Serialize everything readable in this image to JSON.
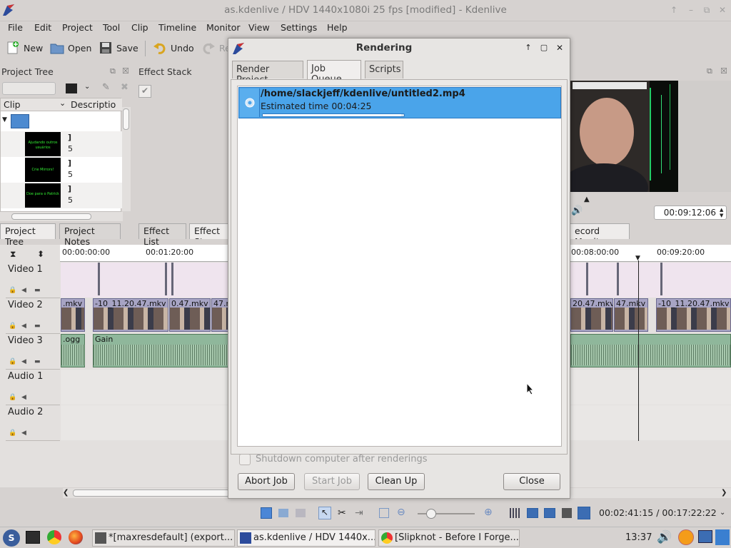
{
  "window": {
    "title": "as.kdenlive / HDV 1440x1080i 25 fps [modified] - Kdenlive"
  },
  "menu": [
    "File",
    "Edit",
    "Project",
    "Tool",
    "Clip",
    "Timeline",
    "Monitor",
    "View",
    "Settings",
    "Help"
  ],
  "toolbar": {
    "new_label": "New",
    "open_label": "Open",
    "save_label": "Save",
    "undo_label": "Undo",
    "redo_label": "Re"
  },
  "project_tree": {
    "title": "Project Tree",
    "columns": [
      "Clip",
      "Descriptio"
    ],
    "thumbs": [
      {
        "text": "Ajudando outros usuários",
        "name": "]",
        "dur": "5"
      },
      {
        "text": "Crie Mirrors!",
        "name": "]",
        "dur": "5"
      },
      {
        "text": "Doe para o Patrick",
        "name": "]",
        "dur": "5"
      }
    ]
  },
  "effect_stack": {
    "title": "Effect Stack"
  },
  "bottom_tabs": [
    "Project Tree",
    "Project Notes",
    "Effect List",
    "Effect St",
    "ecord Monitor"
  ],
  "monitor": {
    "timecode": "00:09:12:06"
  },
  "timeline": {
    "ruler_labels": [
      "00:00:00:00",
      "00:01:20:00",
      "00:08:00:00",
      "00:09:20:00"
    ],
    "tracks": [
      "Video 1",
      "Video 2",
      "Video 3",
      "Audio 1",
      "Audio 2"
    ],
    "clip_labels": [
      ".mkv",
      "-10_11.20.47.mkv",
      "0.47.mkv",
      "47.m",
      "20.47.mkv",
      "47.mkv",
      "-10_11.20.47.mkv"
    ],
    "audio_labels": [
      ".ogg",
      "Gain"
    ],
    "position": "00:02:41:15 / 00:17:22:22"
  },
  "dialog": {
    "title": "Rendering",
    "tabs": [
      "Render Project",
      "Job Queue",
      "Scripts"
    ],
    "job": {
      "path": "/home/slackjeff/kdenlive/untitled2.mp4",
      "estimate": "Estimated time 00:04:25",
      "progress": 0.98
    },
    "shutdown_label": "Shutdown computer after renderings",
    "abort_label": "Abort Job",
    "start_label": "Start Job",
    "cleanup_label": "Clean Up",
    "close_label": "Close"
  },
  "taskbar": {
    "tasks": [
      "*[maxresdefault] (export...",
      "as.kdenlive / HDV 1440x...",
      "[Slipknot - Before I Forge..."
    ],
    "clock": "13:37"
  }
}
